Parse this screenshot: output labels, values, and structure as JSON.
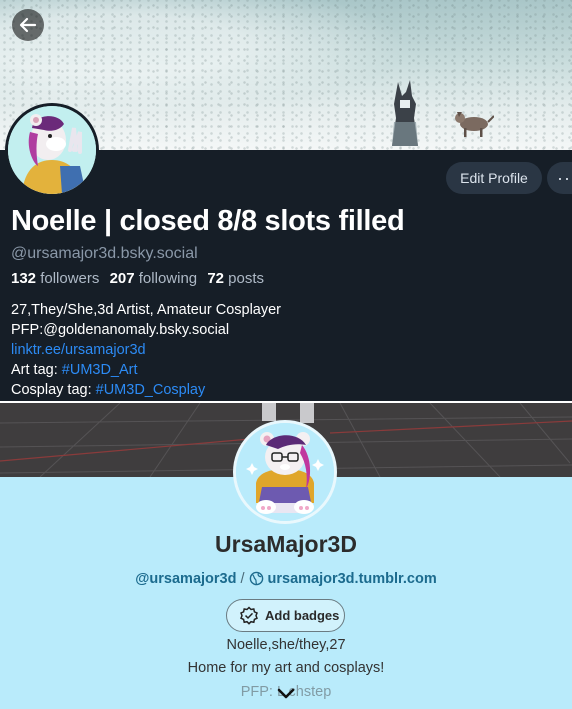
{
  "bluesky": {
    "display_name": "Noelle | closed 8/8 slots filled",
    "handle": "@ursamajor3d.bsky.social",
    "followers_count": "132",
    "followers_label": "followers",
    "following_count": "207",
    "following_label": "following",
    "posts_count": "72",
    "posts_label": "posts",
    "edit_profile_label": "Edit Profile",
    "more_label": "···",
    "bio": {
      "line1": "27,They/She,3d Artist, Amateur Cosplayer",
      "line2": "PFP:@goldenanomaly.bsky.social",
      "line3_link": "linktr.ee/ursamajor3d",
      "line4_prefix": "Art tag: ",
      "line4_tag": "#UM3D_Art",
      "line5_prefix": "Cosplay tag: ",
      "line5_tag": "#UM3D_Cosplay"
    },
    "icons": {
      "back": "arrow-left-icon"
    },
    "colors": {
      "background": "#161e27",
      "link": "#2c8bf5",
      "button": "#2a3644"
    }
  },
  "tumblr": {
    "title": "UrsaMajor3D",
    "handle_link": "@ursamajor3d",
    "separator": "/",
    "site_link": "ursamajor3d.tumblr.com",
    "add_badges_label": "Add badges",
    "description": {
      "line1": "Noelle,she/they,27",
      "line2": "Home for my art and cosplays!",
      "line3": "PFP: L   chstep"
    },
    "icons": {
      "globe": "globe-icon",
      "badge": "badge-icon",
      "expand": "chevron-down-icon"
    },
    "colors": {
      "background": "#b9ebfb",
      "link": "#1c6b8e"
    }
  }
}
